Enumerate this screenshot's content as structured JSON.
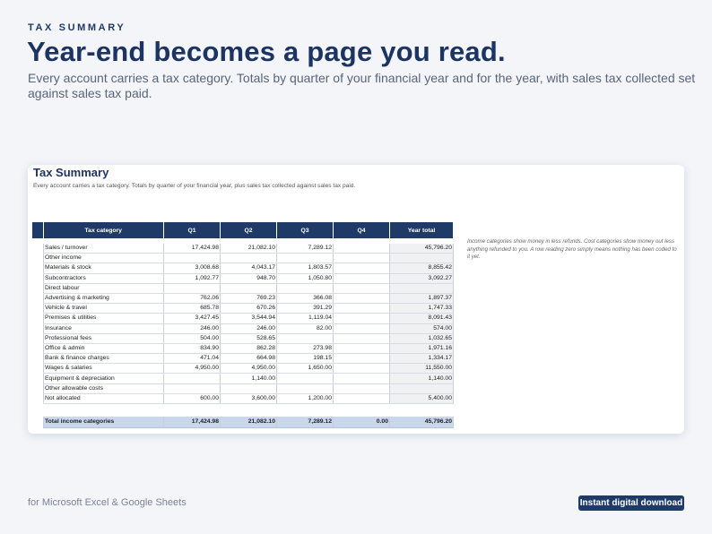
{
  "hero": {
    "eyebrow": "TAX SUMMARY",
    "headline": "Year-end becomes a page you read.",
    "subhead": "Every account carries a tax category. Totals by quarter of your financial year and for the year, with sales tax collected set against sales tax paid."
  },
  "sheet": {
    "title": "Tax Summary",
    "subtitle": "Every account carries a tax category. Totals by quarter of your financial year, plus sales tax collected against sales tax paid.",
    "columns": [
      "Tax category",
      "Q1",
      "Q2",
      "Q3",
      "Q4",
      "Year total"
    ],
    "rows": [
      {
        "cat": "Sales / turnover",
        "q1": "17,424.98",
        "q2": "21,082.10",
        "q3": "7,289.12",
        "q4": "",
        "total": "45,796.20"
      },
      {
        "cat": "Other income",
        "q1": "",
        "q2": "",
        "q3": "",
        "q4": "",
        "total": ""
      },
      {
        "cat": "Materials & stock",
        "q1": "3,008.68",
        "q2": "4,043.17",
        "q3": "1,803.57",
        "q4": "",
        "total": "8,855.42"
      },
      {
        "cat": "Subcontractors",
        "q1": "1,092.77",
        "q2": "948.70",
        "q3": "1,050.80",
        "q4": "",
        "total": "3,092.27"
      },
      {
        "cat": "Direct labour",
        "q1": "",
        "q2": "",
        "q3": "",
        "q4": "",
        "total": ""
      },
      {
        "cat": "Advertising & marketing",
        "q1": "762.06",
        "q2": "769.23",
        "q3": "366.08",
        "q4": "",
        "total": "1,897.37"
      },
      {
        "cat": "Vehicle & travel",
        "q1": "685.78",
        "q2": "670.26",
        "q3": "391.29",
        "q4": "",
        "total": "1,747.33"
      },
      {
        "cat": "Premises & utilities",
        "q1": "3,427.45",
        "q2": "3,544.94",
        "q3": "1,119.04",
        "q4": "",
        "total": "8,091.43"
      },
      {
        "cat": "Insurance",
        "q1": "246.00",
        "q2": "246.00",
        "q3": "82.00",
        "q4": "",
        "total": "574.00"
      },
      {
        "cat": "Professional fees",
        "q1": "504.00",
        "q2": "528.65",
        "q3": "",
        "q4": "",
        "total": "1,032.65"
      },
      {
        "cat": "Office & admin",
        "q1": "834.90",
        "q2": "862.28",
        "q3": "273.98",
        "q4": "",
        "total": "1,971.16"
      },
      {
        "cat": "Bank & finance charges",
        "q1": "471.04",
        "q2": "664.98",
        "q3": "198.15",
        "q4": "",
        "total": "1,334.17"
      },
      {
        "cat": "Wages & salaries",
        "q1": "4,950.00",
        "q2": "4,950.00",
        "q3": "1,650.00",
        "q4": "",
        "total": "11,550.00"
      },
      {
        "cat": "Equipment & depreciation",
        "q1": "",
        "q2": "1,140.00",
        "q3": "",
        "q4": "",
        "total": "1,140.00"
      },
      {
        "cat": "Other allowable costs",
        "q1": "",
        "q2": "",
        "q3": "",
        "q4": "",
        "total": ""
      },
      {
        "cat": "Not allocated",
        "q1": "600.00",
        "q2": "3,600.00",
        "q3": "1,200.00",
        "q4": "",
        "total": "5,400.00"
      }
    ],
    "total_row": {
      "cat": "Total income categories",
      "q1": "17,424.98",
      "q2": "21,082.10",
      "q3": "7,289.12",
      "q4": "0.00",
      "total": "45,796.20"
    },
    "note": "Income categories show money in less refunds. Cost categories show money out less anything refunded to you. A row reading zero simply means nothing has been coded to it yet."
  },
  "footer": {
    "platforms": "for Microsoft Excel & Google Sheets",
    "badge": "Instant digital download"
  }
}
